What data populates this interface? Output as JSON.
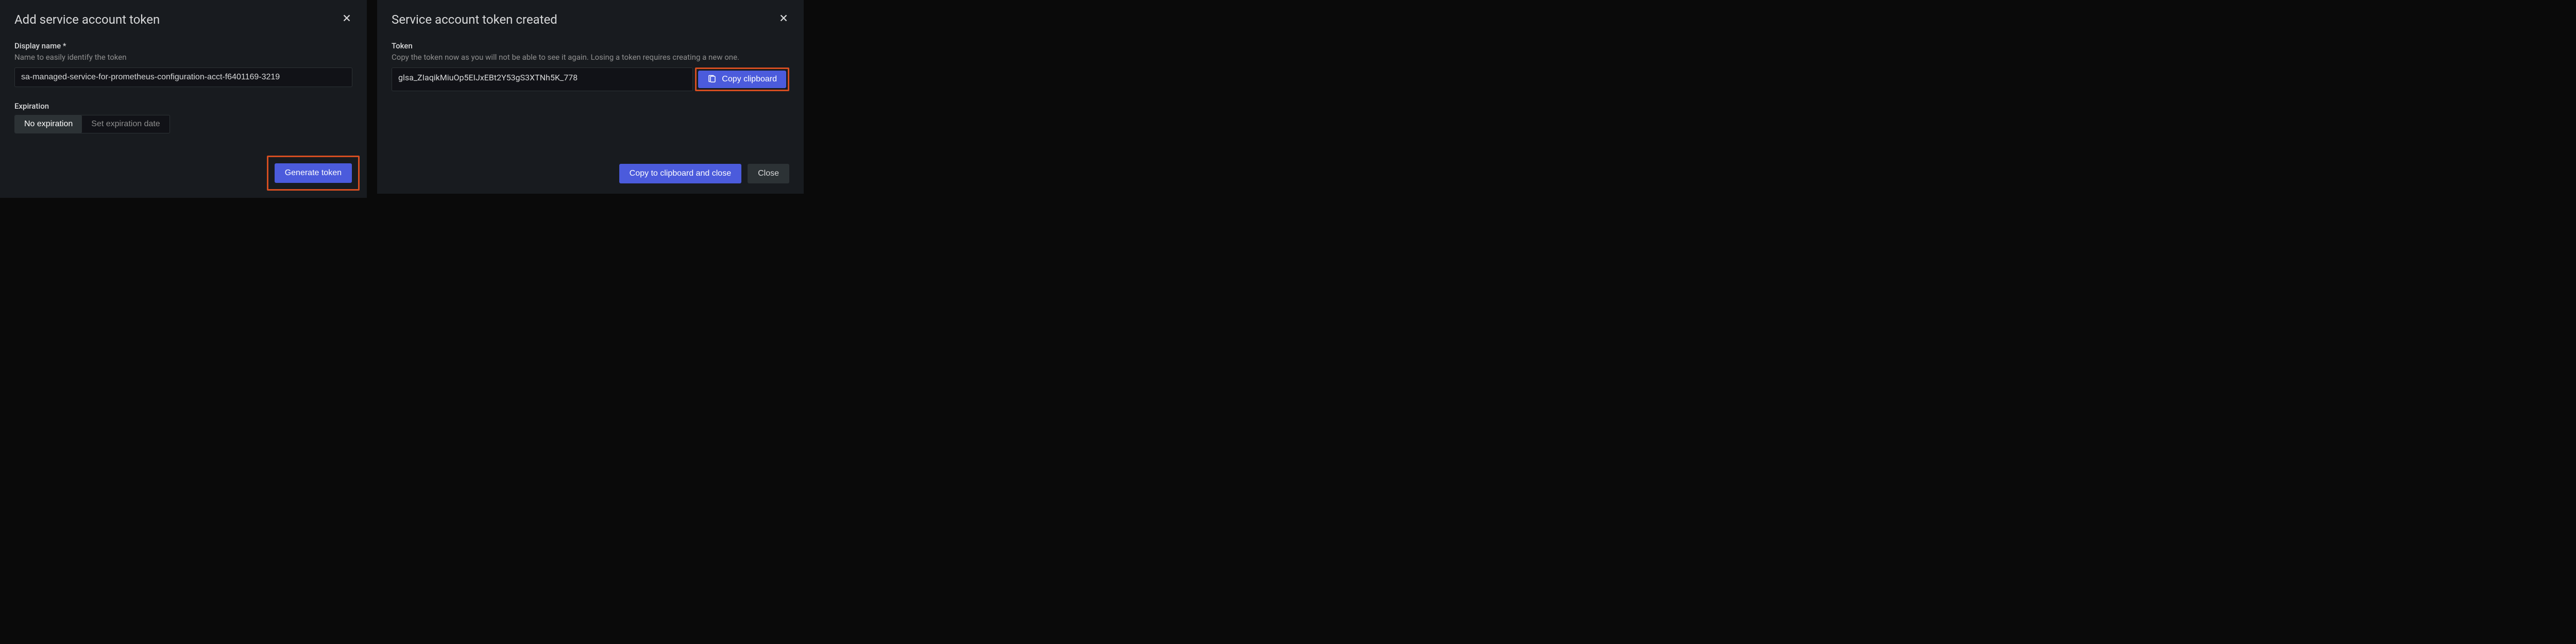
{
  "left_modal": {
    "title": "Add service account token",
    "display_name": {
      "label": "Display name *",
      "help": "Name to easily identify the token",
      "value": "sa-managed-service-for-prometheus-configuration-acct-f6401169-3219"
    },
    "expiration": {
      "label": "Expiration",
      "options": [
        "No expiration",
        "Set expiration date"
      ],
      "selected": 0
    },
    "generate_button": "Generate token"
  },
  "right_modal": {
    "title": "Service account token created",
    "token": {
      "label": "Token",
      "help": "Copy the token now as you will not be able to see it again. Losing a token requires creating a new one.",
      "value": "glsa_ZIaqikMiuOp5EIJxEBt2Y53gS3XTNh5K_778"
    },
    "copy_inline_button": "Copy clipboard",
    "copy_close_button": "Copy to clipboard and close",
    "close_button": "Close"
  }
}
